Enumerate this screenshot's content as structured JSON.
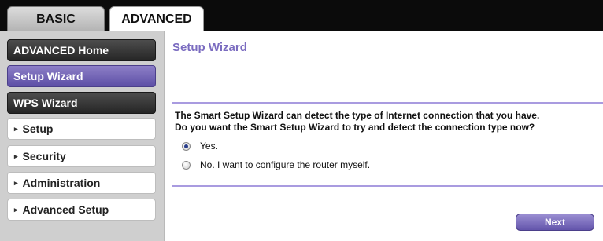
{
  "tabs": {
    "basic": "BASIC",
    "advanced": "ADVANCED"
  },
  "sidebar": {
    "items": [
      {
        "label": "ADVANCED Home",
        "style": "dark"
      },
      {
        "label": "Setup Wizard",
        "style": "active"
      },
      {
        "label": "WPS Wizard",
        "style": "dark"
      },
      {
        "label": "Setup",
        "style": "collapsed",
        "arrow": "▸"
      },
      {
        "label": "Security",
        "style": "collapsed",
        "arrow": "▸"
      },
      {
        "label": "Administration",
        "style": "collapsed",
        "arrow": "▸"
      },
      {
        "label": "Advanced Setup",
        "style": "collapsed",
        "arrow": "▸"
      }
    ]
  },
  "main": {
    "title": "Setup Wizard",
    "description_line1": "The Smart Setup Wizard can detect the type of Internet connection that you have.",
    "description_line2": "Do you want the Smart Setup Wizard to try and detect the connection type now?",
    "options": [
      {
        "label": "Yes.",
        "checked": true
      },
      {
        "label": "No. I want to configure the router myself.",
        "checked": false
      }
    ],
    "next_label": "Next"
  },
  "colors": {
    "accent_purple": "#7b6cc0",
    "active_nav": "#6a5bb2",
    "dark_nav": "#333333",
    "topbar": "#0b0b0b"
  }
}
